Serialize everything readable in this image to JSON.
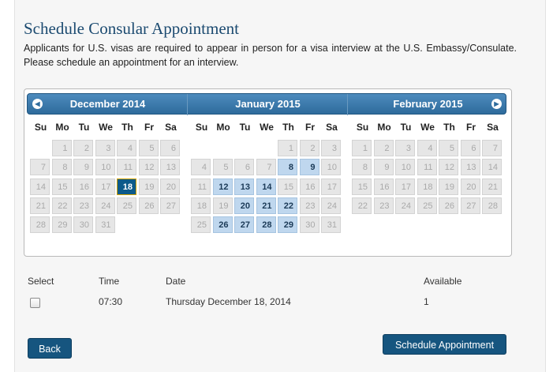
{
  "page": {
    "title": "Schedule Consular Appointment",
    "intro": "Applicants for U.S. visas are required to appear in person for a visa interview at the U.S. Embassy/Consulate. Please schedule an appointment for an interview."
  },
  "calendar": {
    "months": [
      {
        "title": "December 2014",
        "first_weekday": 1,
        "days": 31,
        "available": [],
        "selected": 18
      },
      {
        "title": "January 2015",
        "first_weekday": 4,
        "days": 31,
        "available": [
          8,
          9,
          12,
          13,
          14,
          20,
          21,
          22,
          26,
          27,
          28,
          29
        ],
        "selected": null
      },
      {
        "title": "February 2015",
        "first_weekday": 0,
        "days": 28,
        "available": [],
        "selected": null
      }
    ],
    "weekdays": [
      "Su",
      "Mo",
      "Tu",
      "We",
      "Th",
      "Fr",
      "Sa"
    ],
    "prev_icon": "arrow-left-icon",
    "next_icon": "arrow-right-icon"
  },
  "table": {
    "headers": {
      "select": "Select",
      "time": "Time",
      "date": "Date",
      "available": "Available"
    },
    "rows": [
      {
        "time": "07:30",
        "date": "Thursday December 18, 2014",
        "available": "1",
        "checked": false
      }
    ]
  },
  "buttons": {
    "back": "Back",
    "schedule": "Schedule Appointment"
  },
  "colors": {
    "accent": "#16557f",
    "available_day": "#bfd7ee",
    "selected_day": "#0c5a8a"
  }
}
